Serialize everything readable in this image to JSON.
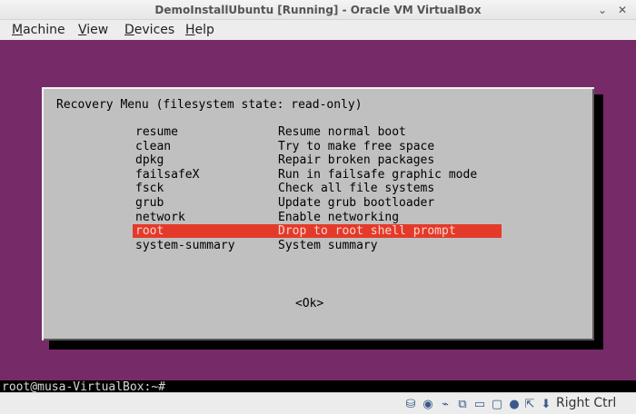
{
  "window": {
    "title": "DemoInstallUbuntu [Running] - Oracle VM VirtualBox",
    "minimize_glyph": "⌄",
    "close_glyph": "✕"
  },
  "menubar": {
    "items": [
      {
        "mnemonic": "M",
        "rest": "achine"
      },
      {
        "mnemonic": "V",
        "rest": "iew"
      },
      {
        "mnemonic": "D",
        "rest": "evices"
      },
      {
        "mnemonic": "H",
        "rest": "elp"
      }
    ]
  },
  "recovery": {
    "title": "Recovery Menu (filesystem state: read-only)",
    "options": [
      {
        "name": "resume",
        "description": "Resume normal boot"
      },
      {
        "name": "clean",
        "description": "Try to make free space"
      },
      {
        "name": "dpkg",
        "description": "Repair broken packages"
      },
      {
        "name": "failsafeX",
        "description": "Run in failsafe graphic mode"
      },
      {
        "name": "fsck",
        "description": "Check all file systems"
      },
      {
        "name": "grub",
        "description": "Update grub bootloader"
      },
      {
        "name": "network",
        "description": "Enable networking"
      },
      {
        "name": "root",
        "description": "Drop to root shell prompt"
      },
      {
        "name": "system-summary",
        "description": "System summary"
      }
    ],
    "selected_index": 7,
    "ok_label": "<Ok>"
  },
  "terminal": {
    "prompt": "root@musa-VirtualBox:~# _"
  },
  "statusbar": {
    "icons": [
      "hard-disk-icon",
      "optical-drive-icon",
      "usb-icon",
      "network-icon",
      "shared-folders-icon",
      "display-icon",
      "video-capture-icon",
      "mouse-integration-icon",
      "host-key-arrow-icon"
    ],
    "glyphs": [
      "⛁",
      "◉",
      "⌁",
      "⧉",
      "▭",
      "▢",
      "●",
      "⇱",
      "⬇"
    ],
    "host_key": "Right Ctrl"
  }
}
